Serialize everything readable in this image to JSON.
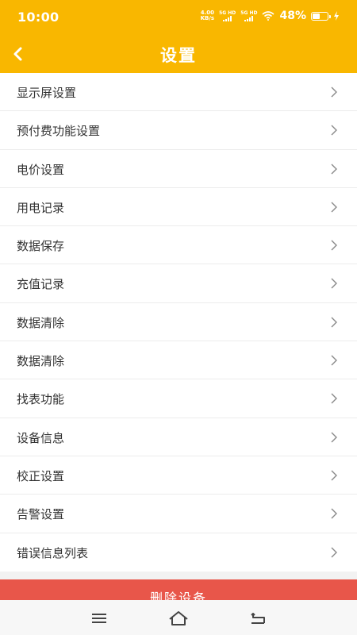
{
  "status_bar": {
    "time": "10:00",
    "net_speed_value": "4.00",
    "net_speed_unit": "KB/s",
    "sim1_label": "5G HD",
    "sim2_label": "5G HD",
    "battery_percent": "48%"
  },
  "header": {
    "title": "设置",
    "back_icon": "chevron-left-icon"
  },
  "settings_items": [
    {
      "label": "显示屏设置"
    },
    {
      "label": "预付费功能设置"
    },
    {
      "label": "电价设置"
    },
    {
      "label": "用电记录"
    },
    {
      "label": "数据保存"
    },
    {
      "label": "充值记录"
    },
    {
      "label": "数据清除"
    },
    {
      "label": "数据清除"
    },
    {
      "label": "找表功能"
    },
    {
      "label": "设备信息"
    },
    {
      "label": "校正设置"
    },
    {
      "label": "告警设置"
    },
    {
      "label": "错误信息列表"
    }
  ],
  "footer": {
    "delete_label": "删除设备"
  },
  "colors": {
    "header_bg": "#f9b700",
    "delete_bg": "#e8564a"
  }
}
